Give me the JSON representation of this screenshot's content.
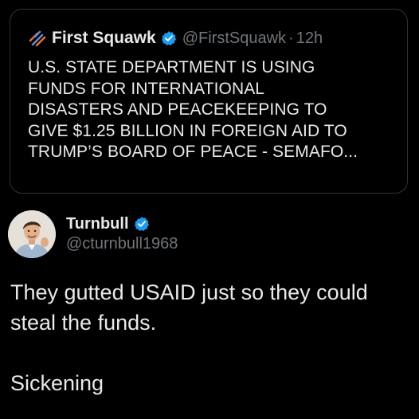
{
  "quoted_tweet": {
    "author_name": "First Squawk",
    "handle": "@FirstSquawk",
    "separator": "·",
    "time": "12h",
    "text_lines": [
      "U.S. STATE DEPARTMENT IS USING",
      "FUNDS FOR INTERNATIONAL",
      "DISASTERS AND PEACEKEEPING TO",
      "GIVE $1.25 BILLION IN FOREIGN AID TO",
      "TRUMP’S BOARD OF PEACE - SEMAFO..."
    ],
    "brand_icon": "first-squawk-logo-icon",
    "verified_icon": "verified-badge-icon"
  },
  "tweet": {
    "author_name": "Turnbull",
    "handle": "@cturnbull1968",
    "verified_icon": "verified-badge-icon",
    "avatar_icon": "avatar-portrait",
    "body_lines": [
      "They gutted USAID just so they could",
      "steal the funds.",
      "",
      "Sickening"
    ]
  },
  "colors": {
    "background": "#000000",
    "text_primary": "#e7e9ea",
    "text_secondary": "#71767b",
    "verified_blue": "#1d9bf0",
    "card_border": "#2f3336",
    "brand_orange": "#f26a2e",
    "brand_blue": "#5b8fd9"
  }
}
